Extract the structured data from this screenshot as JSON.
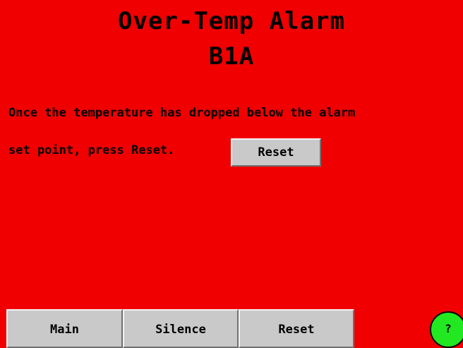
{
  "colors": {
    "background": "#f00000",
    "button": "#c9c9c9",
    "help_button": "#22e822",
    "text": "#000000"
  },
  "header": {
    "title": "Over-Temp Alarm",
    "subtitle": "B1A"
  },
  "message": {
    "line1": "Once the temperature has dropped below the alarm",
    "line2": "set point, press Reset."
  },
  "inline_button": {
    "label": "Reset"
  },
  "bottom_bar": {
    "main_label": "Main",
    "silence_label": "Silence",
    "reset_label": "Reset"
  },
  "help_button": {
    "label": "?",
    "icon": "help-icon"
  }
}
